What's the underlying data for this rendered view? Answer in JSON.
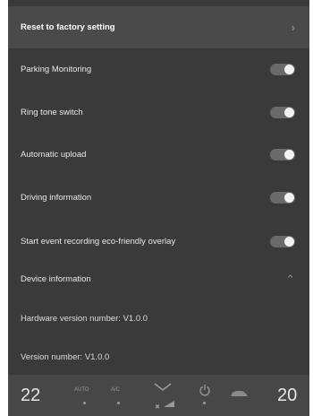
{
  "settings": {
    "reset_label": "Reset to factory setting",
    "items": [
      {
        "label": "Parking Monitoring",
        "enabled": true
      },
      {
        "label": "Ring tone switch",
        "enabled": true
      },
      {
        "label": "Automatic upload",
        "enabled": true
      },
      {
        "label": "Driving information",
        "enabled": true
      },
      {
        "label": "Start event recording eco-friendly overlay",
        "enabled": true
      }
    ],
    "device_info_label": "Device information",
    "hardware_version": "Hardware version number: V1.0.0",
    "version": "Version number: V1.0.0"
  },
  "dock": {
    "temp_left": "22",
    "auto_label": "AUTO",
    "ac_label": "A/C",
    "temp_right": "20"
  },
  "colors": {
    "background": "#3a3a3a",
    "header": "#4a4a4a",
    "toggle_track": "#6a6a6a",
    "toggle_knob": "#f2f2f2"
  }
}
